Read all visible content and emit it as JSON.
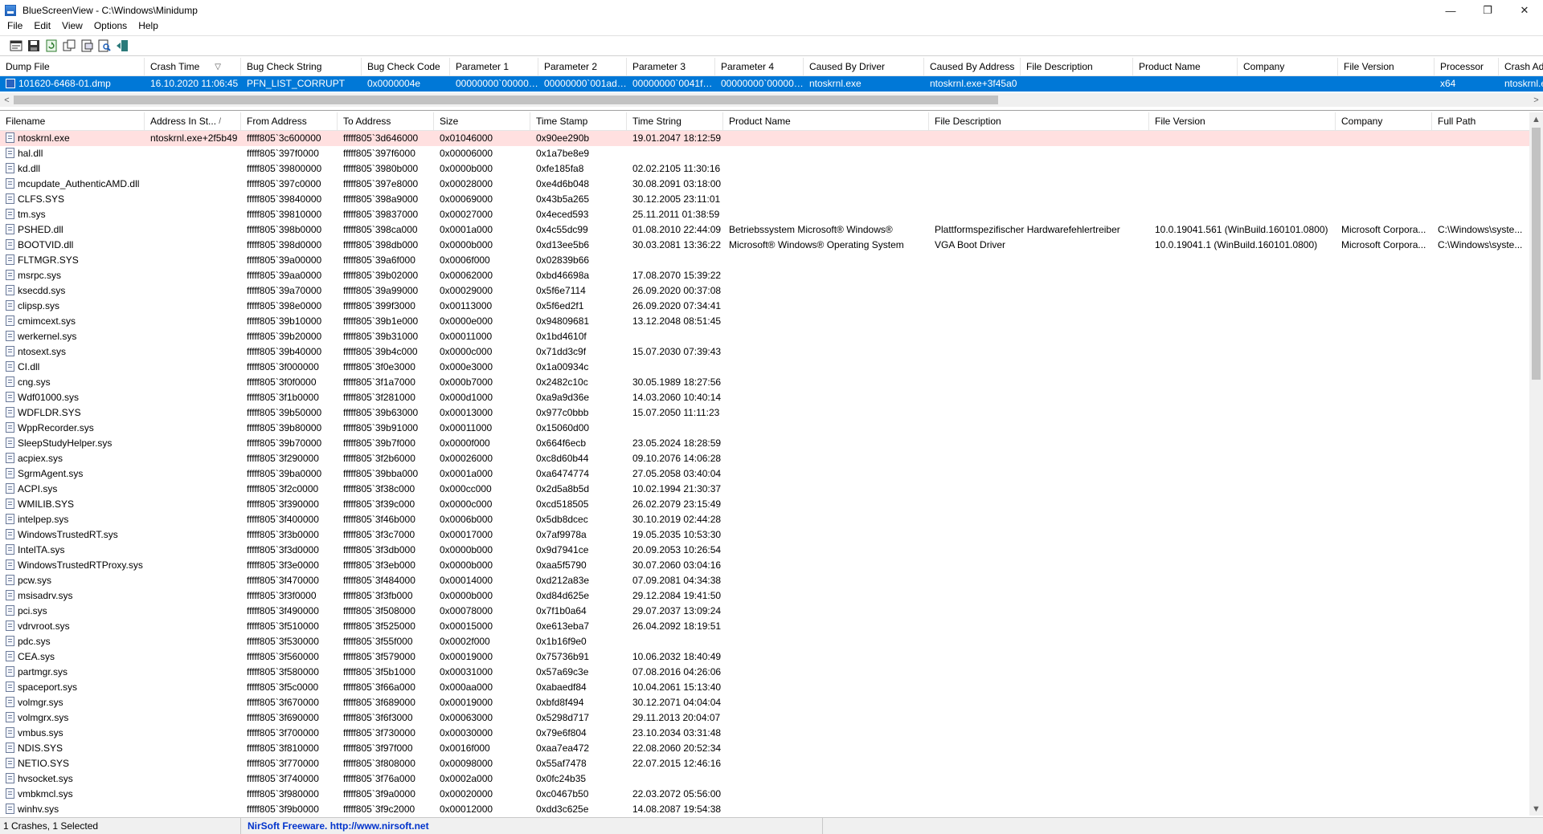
{
  "window": {
    "title": "BlueScreenView  -  C:\\Windows\\Minidump",
    "minimize_glyph": "—",
    "maximize_glyph": "❐",
    "close_glyph": "✕"
  },
  "menu": [
    "File",
    "Edit",
    "View",
    "Options",
    "Help"
  ],
  "toolbar_icons": [
    "properties-icon",
    "save-icon",
    "refresh-icon",
    "copy-icon",
    "html-report-icon",
    "find-icon",
    "exit-icon"
  ],
  "upper": {
    "columns": [
      "Dump File",
      "Crash Time",
      "Bug Check String",
      "Bug Check Code",
      "Parameter 1",
      "Parameter 2",
      "Parameter 3",
      "Parameter 4",
      "Caused By Driver",
      "Caused By Address",
      "File Description",
      "Product Name",
      "Company",
      "File Version",
      "Processor",
      "Crash Address"
    ],
    "sort_indicator": "▽",
    "rows": [
      [
        "101620-6468-01.dmp",
        "16.10.2020 11:06:45",
        "PFN_LIST_CORRUPT",
        "0x0000004e",
        "00000000`000000...",
        "00000000`001ad8...",
        "00000000`0041f37f",
        "00000000`000000...",
        "ntoskrnl.exe",
        "ntoskrnl.exe+3f45a0",
        "",
        "",
        "",
        "",
        "x64",
        "ntoskrnl.e"
      ]
    ],
    "scroll_left": "<",
    "scroll_right": ">"
  },
  "lower": {
    "columns": [
      "Filename",
      "Address In St...",
      "From Address",
      "To Address",
      "Size",
      "Time Stamp",
      "Time String",
      "Product Name",
      "File Description",
      "File Version",
      "Company",
      "Full Path"
    ],
    "sort_indicator": "/",
    "rows": [
      [
        "ntoskrnl.exe",
        "ntoskrnl.exe+2f5b49",
        "fffff805`3c600000",
        "fffff805`3d646000",
        "0x01046000",
        "0x90ee290b",
        "19.01.2047 18:12:59",
        "",
        "",
        "",
        "",
        ""
      ],
      [
        "hal.dll",
        "",
        "fffff805`397f0000",
        "fffff805`397f6000",
        "0x00006000",
        "0x1a7be8e9",
        "",
        "",
        "",
        "",
        "",
        ""
      ],
      [
        "kd.dll",
        "",
        "fffff805`39800000",
        "fffff805`3980b000",
        "0x0000b000",
        "0xfe185fa8",
        "02.02.2105 11:30:16",
        "",
        "",
        "",
        "",
        ""
      ],
      [
        "mcupdate_AuthenticAMD.dll",
        "",
        "fffff805`397c0000",
        "fffff805`397e8000",
        "0x00028000",
        "0xe4d6b048",
        "30.08.2091 03:18:00",
        "",
        "",
        "",
        "",
        ""
      ],
      [
        "CLFS.SYS",
        "",
        "fffff805`39840000",
        "fffff805`398a9000",
        "0x00069000",
        "0x43b5a265",
        "30.12.2005 23:11:01",
        "",
        "",
        "",
        "",
        ""
      ],
      [
        "tm.sys",
        "",
        "fffff805`39810000",
        "fffff805`39837000",
        "0x00027000",
        "0x4eced593",
        "25.11.2011 01:38:59",
        "",
        "",
        "",
        "",
        ""
      ],
      [
        "PSHED.dll",
        "",
        "fffff805`398b0000",
        "fffff805`398ca000",
        "0x0001a000",
        "0x4c55dc99",
        "01.08.2010 22:44:09",
        "Betriebssystem Microsoft® Windows®",
        "Plattformspezifischer Hardwarefehlertreiber",
        "10.0.19041.561 (WinBuild.160101.0800)",
        "Microsoft Corpora...",
        "C:\\Windows\\syste..."
      ],
      [
        "BOOTVID.dll",
        "",
        "fffff805`398d0000",
        "fffff805`398db000",
        "0x0000b000",
        "0xd13ee5b6",
        "30.03.2081 13:36:22",
        "Microsoft® Windows® Operating System",
        "VGA Boot Driver",
        "10.0.19041.1 (WinBuild.160101.0800)",
        "Microsoft Corpora...",
        "C:\\Windows\\syste..."
      ],
      [
        "FLTMGR.SYS",
        "",
        "fffff805`39a00000",
        "fffff805`39a6f000",
        "0x0006f000",
        "0x02839b66",
        "",
        "",
        "",
        "",
        "",
        ""
      ],
      [
        "msrpc.sys",
        "",
        "fffff805`39aa0000",
        "fffff805`39b02000",
        "0x00062000",
        "0xbd46698a",
        "17.08.2070 15:39:22",
        "",
        "",
        "",
        "",
        ""
      ],
      [
        "ksecdd.sys",
        "",
        "fffff805`39a70000",
        "fffff805`39a99000",
        "0x00029000",
        "0x5f6e7114",
        "26.09.2020 00:37:08",
        "",
        "",
        "",
        "",
        ""
      ],
      [
        "clipsp.sys",
        "",
        "fffff805`398e0000",
        "fffff805`399f3000",
        "0x00113000",
        "0x5f6ed2f1",
        "26.09.2020 07:34:41",
        "",
        "",
        "",
        "",
        ""
      ],
      [
        "cmimcext.sys",
        "",
        "fffff805`39b10000",
        "fffff805`39b1e000",
        "0x0000e000",
        "0x94809681",
        "13.12.2048 08:51:45",
        "",
        "",
        "",
        "",
        ""
      ],
      [
        "werkernel.sys",
        "",
        "fffff805`39b20000",
        "fffff805`39b31000",
        "0x00011000",
        "0x1bd4610f",
        "",
        "",
        "",
        "",
        "",
        ""
      ],
      [
        "ntosext.sys",
        "",
        "fffff805`39b40000",
        "fffff805`39b4c000",
        "0x0000c000",
        "0x71dd3c9f",
        "15.07.2030 07:39:43",
        "",
        "",
        "",
        "",
        ""
      ],
      [
        "CI.dll",
        "",
        "fffff805`3f000000",
        "fffff805`3f0e3000",
        "0x000e3000",
        "0x1a00934c",
        "",
        "",
        "",
        "",
        "",
        ""
      ],
      [
        "cng.sys",
        "",
        "fffff805`3f0f0000",
        "fffff805`3f1a7000",
        "0x000b7000",
        "0x2482c10c",
        "30.05.1989 18:27:56",
        "",
        "",
        "",
        "",
        ""
      ],
      [
        "Wdf01000.sys",
        "",
        "fffff805`3f1b0000",
        "fffff805`3f281000",
        "0x000d1000",
        "0xa9a9d36e",
        "14.03.2060 10:40:14",
        "",
        "",
        "",
        "",
        ""
      ],
      [
        "WDFLDR.SYS",
        "",
        "fffff805`39b50000",
        "fffff805`39b63000",
        "0x00013000",
        "0x977c0bbb",
        "15.07.2050 11:11:23",
        "",
        "",
        "",
        "",
        ""
      ],
      [
        "WppRecorder.sys",
        "",
        "fffff805`39b80000",
        "fffff805`39b91000",
        "0x00011000",
        "0x15060d00",
        "",
        "",
        "",
        "",
        "",
        ""
      ],
      [
        "SleepStudyHelper.sys",
        "",
        "fffff805`39b70000",
        "fffff805`39b7f000",
        "0x0000f000",
        "0x664f6ecb",
        "23.05.2024 18:28:59",
        "",
        "",
        "",
        "",
        ""
      ],
      [
        "acpiex.sys",
        "",
        "fffff805`3f290000",
        "fffff805`3f2b6000",
        "0x00026000",
        "0xc8d60b44",
        "09.10.2076 14:06:28",
        "",
        "",
        "",
        "",
        ""
      ],
      [
        "SgrmAgent.sys",
        "",
        "fffff805`39ba0000",
        "fffff805`39bba000",
        "0x0001a000",
        "0xa6474774",
        "27.05.2058 03:40:04",
        "",
        "",
        "",
        "",
        ""
      ],
      [
        "ACPI.sys",
        "",
        "fffff805`3f2c0000",
        "fffff805`3f38c000",
        "0x000cc000",
        "0x2d5a8b5d",
        "10.02.1994 21:30:37",
        "",
        "",
        "",
        "",
        ""
      ],
      [
        "WMILIB.SYS",
        "",
        "fffff805`3f390000",
        "fffff805`3f39c000",
        "0x0000c000",
        "0xcd518505",
        "26.02.2079 23:15:49",
        "",
        "",
        "",
        "",
        ""
      ],
      [
        "intelpep.sys",
        "",
        "fffff805`3f400000",
        "fffff805`3f46b000",
        "0x0006b000",
        "0x5db8dcec",
        "30.10.2019 02:44:28",
        "",
        "",
        "",
        "",
        ""
      ],
      [
        "WindowsTrustedRT.sys",
        "",
        "fffff805`3f3b0000",
        "fffff805`3f3c7000",
        "0x00017000",
        "0x7af9978a",
        "19.05.2035 10:53:30",
        "",
        "",
        "",
        "",
        ""
      ],
      [
        "IntelTA.sys",
        "",
        "fffff805`3f3d0000",
        "fffff805`3f3db000",
        "0x0000b000",
        "0x9d7941ce",
        "20.09.2053 10:26:54",
        "",
        "",
        "",
        "",
        ""
      ],
      [
        "WindowsTrustedRTProxy.sys",
        "",
        "fffff805`3f3e0000",
        "fffff805`3f3eb000",
        "0x0000b000",
        "0xaa5f5790",
        "30.07.2060 03:04:16",
        "",
        "",
        "",
        "",
        ""
      ],
      [
        "pcw.sys",
        "",
        "fffff805`3f470000",
        "fffff805`3f484000",
        "0x00014000",
        "0xd212a83e",
        "07.09.2081 04:34:38",
        "",
        "",
        "",
        "",
        ""
      ],
      [
        "msisadrv.sys",
        "",
        "fffff805`3f3f0000",
        "fffff805`3f3fb000",
        "0x0000b000",
        "0xd84d625e",
        "29.12.2084 19:41:50",
        "",
        "",
        "",
        "",
        ""
      ],
      [
        "pci.sys",
        "",
        "fffff805`3f490000",
        "fffff805`3f508000",
        "0x00078000",
        "0x7f1b0a64",
        "29.07.2037 13:09:24",
        "",
        "",
        "",
        "",
        ""
      ],
      [
        "vdrvroot.sys",
        "",
        "fffff805`3f510000",
        "fffff805`3f525000",
        "0x00015000",
        "0xe613eba7",
        "26.04.2092 18:19:51",
        "",
        "",
        "",
        "",
        ""
      ],
      [
        "pdc.sys",
        "",
        "fffff805`3f530000",
        "fffff805`3f55f000",
        "0x0002f000",
        "0x1b16f9e0",
        "",
        "",
        "",
        "",
        "",
        ""
      ],
      [
        "CEA.sys",
        "",
        "fffff805`3f560000",
        "fffff805`3f579000",
        "0x00019000",
        "0x75736b91",
        "10.06.2032 18:40:49",
        "",
        "",
        "",
        "",
        ""
      ],
      [
        "partmgr.sys",
        "",
        "fffff805`3f580000",
        "fffff805`3f5b1000",
        "0x00031000",
        "0x57a69c3e",
        "07.08.2016 04:26:06",
        "",
        "",
        "",
        "",
        ""
      ],
      [
        "spaceport.sys",
        "",
        "fffff805`3f5c0000",
        "fffff805`3f66a000",
        "0x000aa000",
        "0xabaedf84",
        "10.04.2061 15:13:40",
        "",
        "",
        "",
        "",
        ""
      ],
      [
        "volmgr.sys",
        "",
        "fffff805`3f670000",
        "fffff805`3f689000",
        "0x00019000",
        "0xbfd8f494",
        "30.12.2071 04:04:04",
        "",
        "",
        "",
        "",
        ""
      ],
      [
        "volmgrx.sys",
        "",
        "fffff805`3f690000",
        "fffff805`3f6f3000",
        "0x00063000",
        "0x5298d717",
        "29.11.2013 20:04:07",
        "",
        "",
        "",
        "",
        ""
      ],
      [
        "vmbus.sys",
        "",
        "fffff805`3f700000",
        "fffff805`3f730000",
        "0x00030000",
        "0x79e6f804",
        "23.10.2034 03:31:48",
        "",
        "",
        "",
        "",
        ""
      ],
      [
        "NDIS.SYS",
        "",
        "fffff805`3f810000",
        "fffff805`3f97f000",
        "0x0016f000",
        "0xaa7ea472",
        "22.08.2060 20:52:34",
        "",
        "",
        "",
        "",
        ""
      ],
      [
        "NETIO.SYS",
        "",
        "fffff805`3f770000",
        "fffff805`3f808000",
        "0x00098000",
        "0x55af7478",
        "22.07.2015 12:46:16",
        "",
        "",
        "",
        "",
        ""
      ],
      [
        "hvsocket.sys",
        "",
        "fffff805`3f740000",
        "fffff805`3f76a000",
        "0x0002a000",
        "0x0fc24b35",
        "",
        "",
        "",
        "",
        "",
        ""
      ],
      [
        "vmbkmcl.sys",
        "",
        "fffff805`3f980000",
        "fffff805`3f9a0000",
        "0x00020000",
        "0xc0467b50",
        "22.03.2072 05:56:00",
        "",
        "",
        "",
        "",
        ""
      ],
      [
        "winhv.sys",
        "",
        "fffff805`3f9b0000",
        "fffff805`3f9c2000",
        "0x00012000",
        "0xdd3c625e",
        "14.08.2087 19:54:38",
        "",
        "",
        "",
        "",
        ""
      ]
    ]
  },
  "status": {
    "count": "1 Crashes, 1 Selected",
    "freeware": "NirSoft Freeware.  http://www.nirsoft.net"
  },
  "colors": {
    "selection": "#0078d7",
    "error_row": "#ffe0e0",
    "nirsoft_link": "#0033cc"
  }
}
